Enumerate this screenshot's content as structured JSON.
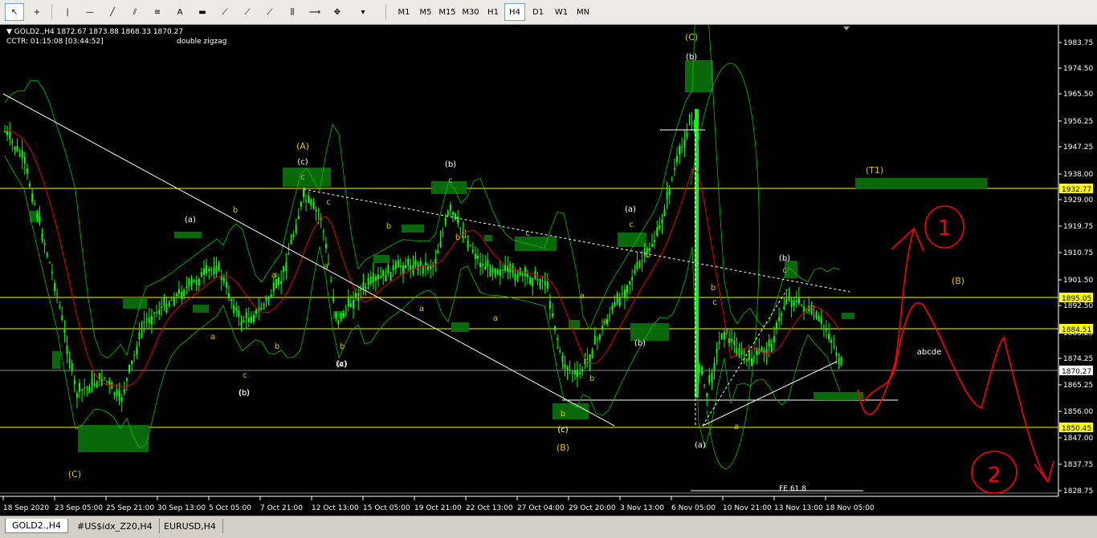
{
  "toolbar": {
    "tools": [
      {
        "name": "cursor-icon",
        "glyph": "↖"
      },
      {
        "name": "crosshair-icon",
        "glyph": "+"
      },
      {
        "name": "vertical-line-icon",
        "glyph": "|"
      },
      {
        "name": "horizontal-line-icon",
        "glyph": "—"
      },
      {
        "name": "trendline-icon",
        "glyph": "╱"
      },
      {
        "name": "channel-icon",
        "glyph": "⫽"
      },
      {
        "name": "fibonacci-icon",
        "glyph": "≡"
      },
      {
        "name": "text-icon",
        "glyph": "A"
      },
      {
        "name": "rectangle-icon",
        "glyph": "▬"
      },
      {
        "name": "gann-icon",
        "glyph": "⟋"
      },
      {
        "name": "pitchfork-icon",
        "glyph": "⟋"
      },
      {
        "name": "fib-fan-icon",
        "glyph": "⟋"
      },
      {
        "name": "fib-time-icon",
        "glyph": "⫼"
      },
      {
        "name": "arrow-icon",
        "glyph": "⟿"
      },
      {
        "name": "shapes-icon",
        "glyph": "✥"
      }
    ],
    "timeframes": [
      "M1",
      "M5",
      "M15",
      "M30",
      "H1",
      "H4",
      "D1",
      "W1",
      "MN"
    ],
    "active_timeframe": "H4"
  },
  "chart": {
    "symbol_line": "GOLD2.,H4  1872.67 1873.88 1868.33 1870.27",
    "cctr_line": "CCTR: 01:15:08 [03:44:52]",
    "indicator_label": "double zigzag",
    "price_axis": [
      "1983.75",
      "1974.50",
      "1965.50",
      "1956.25",
      "1947.25",
      "1938.00",
      "1929.00",
      "1919.75",
      "1910.75",
      "1901.50",
      "1892.50",
      "1883.25",
      "1874.25",
      "1865.25",
      "1856.00",
      "1847.00",
      "1837.75",
      "1828.75"
    ],
    "price_markers": [
      {
        "label": "1932.77",
        "color": "#ffff00"
      },
      {
        "label": "1895.05",
        "color": "#ffff00"
      },
      {
        "label": "1884.51",
        "color": "#ffff00"
      },
      {
        "label": "1870.27",
        "color": "#ffffff"
      },
      {
        "label": "1850.45",
        "color": "#ffff00"
      }
    ],
    "time_axis": [
      "18 Sep 2020",
      "23 Sep 05:00",
      "25 Sep 21:00",
      "30 Sep 13:00",
      "5 Oct 05:00",
      "7 Oct 21:00",
      "12 Oct 13:00",
      "15 Oct 05:00",
      "19 Oct 21:00",
      "22 Oct 13:00",
      "27 Oct 04:00",
      "29 Oct 20:00",
      "3 Nov 13:00",
      "6 Nov 05:00",
      "10 Nov 21:00",
      "13 Nov 13:00",
      "18 Nov 05:00"
    ],
    "wave_labels": {
      "yellow": [
        "(C)",
        "(A)",
        "(C)",
        "(B)",
        "(B)",
        "(T1)"
      ],
      "white": [
        "(a)",
        "(c)",
        "(b)",
        "(c)",
        "(b)",
        "(a)",
        "(b)",
        "(c)",
        "(b)",
        "(a)",
        "(b)",
        "(a)",
        "(c)"
      ],
      "small": [
        "b",
        "a",
        "c",
        "b",
        "a",
        "c",
        "a",
        "b",
        "c",
        "b",
        "a",
        "c",
        "b",
        "a",
        "c",
        "b",
        "a",
        "b",
        "c",
        "a",
        "b",
        "c",
        "a",
        "c",
        "b"
      ]
    },
    "annotations": {
      "abcde": "abcde",
      "fe": "FE 61.8",
      "drawn_1": "1",
      "drawn_2": "2"
    }
  },
  "tabs": [
    "GOLD2.,H4",
    "#US$idx_Z20,H4",
    "EURUSD,H4"
  ],
  "active_tab": "GOLD2.,H4",
  "colors": {
    "bull_candle": "#00ff00",
    "ma": "#e00000",
    "bands": "#00c000",
    "zones": "#0a6e0a",
    "levels": "#ffff00",
    "annotation": "#ff0000"
  }
}
